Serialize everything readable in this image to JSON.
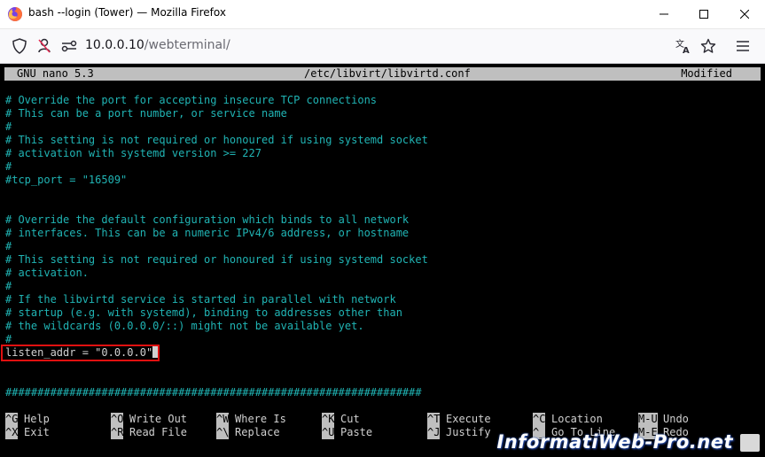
{
  "window": {
    "title": "bash --login (Tower) — Mozilla Firefox"
  },
  "nav": {
    "url_host": "10.0.0.10",
    "url_path": "/webterminal/"
  },
  "nano": {
    "version": "GNU nano 5.3",
    "filename": "/etc/libvirt/libvirtd.conf",
    "status": "Modified"
  },
  "lines": [
    {
      "text": "# Override the port for accepting insecure TCP connections",
      "type": "comment"
    },
    {
      "text": "# This can be a port number, or service name",
      "type": "comment"
    },
    {
      "text": "#",
      "type": "comment"
    },
    {
      "text": "# This setting is not required or honoured if using systemd socket",
      "type": "comment"
    },
    {
      "text": "# activation with systemd version >= 227",
      "type": "comment"
    },
    {
      "text": "#",
      "type": "comment"
    },
    {
      "text": "#tcp_port = \"16509\"",
      "type": "comment"
    },
    {
      "text": "",
      "type": "blank"
    },
    {
      "text": "",
      "type": "blank"
    },
    {
      "text": "# Override the default configuration which binds to all network",
      "type": "comment"
    },
    {
      "text": "# interfaces. This can be a numeric IPv4/6 address, or hostname",
      "type": "comment"
    },
    {
      "text": "#",
      "type": "comment"
    },
    {
      "text": "# This setting is not required or honoured if using systemd socket",
      "type": "comment"
    },
    {
      "text": "# activation.",
      "type": "comment"
    },
    {
      "text": "#",
      "type": "comment"
    },
    {
      "text": "# If the libvirtd service is started in parallel with network",
      "type": "comment"
    },
    {
      "text": "# startup (e.g. with systemd), binding to addresses other than",
      "type": "comment"
    },
    {
      "text": "# the wildcards (0.0.0.0/::) might not be available yet.",
      "type": "comment"
    },
    {
      "text": "#",
      "type": "comment"
    },
    {
      "text": "listen_addr = \"0.0.0.0\"",
      "type": "code"
    },
    {
      "text": "",
      "type": "blank"
    },
    {
      "text": "",
      "type": "blank"
    },
    {
      "text": "#################################################################",
      "type": "comment"
    }
  ],
  "shortcuts": [
    {
      "key": "^G",
      "label": "Help"
    },
    {
      "key": "^X",
      "label": "Exit"
    },
    {
      "key": "^O",
      "label": "Write Out"
    },
    {
      "key": "^R",
      "label": "Read File"
    },
    {
      "key": "^W",
      "label": "Where Is"
    },
    {
      "key": "^\\",
      "label": "Replace"
    },
    {
      "key": "^K",
      "label": "Cut"
    },
    {
      "key": "^U",
      "label": "Paste"
    },
    {
      "key": "^T",
      "label": "Execute"
    },
    {
      "key": "^J",
      "label": "Justify"
    },
    {
      "key": "^C",
      "label": "Location"
    },
    {
      "key": "^_",
      "label": "Go To Line"
    },
    {
      "key": "M-U",
      "label": "Undo"
    },
    {
      "key": "M-E",
      "label": "Redo"
    }
  ],
  "watermark": "InformatiWeb-Pro.net",
  "colors": {
    "comment": "#20b4b4",
    "highlight": "#e01010",
    "terminal_bg": "#000000",
    "header_bg": "#bfbfbf"
  },
  "icons": [
    "firefox-icon",
    "minimize-icon",
    "maximize-icon",
    "close-icon",
    "shield-icon",
    "permissions-icon",
    "site-info-icon",
    "translate-icon",
    "star-icon",
    "menu-icon"
  ]
}
